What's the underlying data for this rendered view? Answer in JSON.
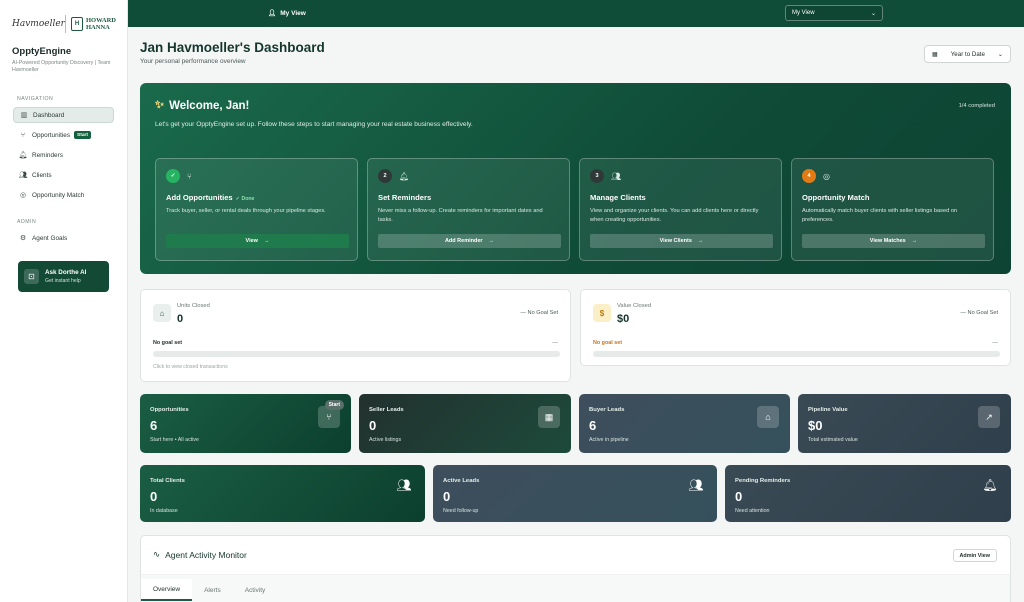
{
  "sidebar": {
    "logo_left": "Havmoeller",
    "logo_right_top": "HOWARD",
    "logo_right_bottom": "HANNA",
    "logo_seal": "H",
    "app_name": "OpptyEngine",
    "tagline": "AI-Powered Opportunity Discovery | Team Havmoeller",
    "nav_label": "NAVIGATION",
    "items": [
      {
        "label": "Dashboard",
        "icon": "bar-chart-icon"
      },
      {
        "label": "Opportunities",
        "icon": "git-branch-icon",
        "badge": "Start"
      },
      {
        "label": "Reminders",
        "icon": "bell-icon"
      },
      {
        "label": "Clients",
        "icon": "users-icon"
      },
      {
        "label": "Opportunity Match",
        "icon": "target-icon"
      }
    ],
    "admin_label": "ADMIN",
    "admin_items": [
      {
        "label": "Agent Goals",
        "icon": "gear-icon"
      }
    ],
    "ask": {
      "title": "Ask Dorthe AI",
      "subtitle": "Get instant help"
    }
  },
  "topbar": {
    "view_label": "My View",
    "select_value": "My View"
  },
  "header": {
    "title": "Jan Havmoeller's Dashboard",
    "subtitle": "Your personal performance overview",
    "period": "Year to Date"
  },
  "welcome": {
    "title": "Welcome, Jan!",
    "completed": "1/4 completed",
    "description": "Let's get your OpptyEngine set up. Follow these steps to start managing your real estate business effectively.",
    "steps": [
      {
        "num": "✓",
        "title": "Add Opportunities",
        "done_tag": "✓ Done",
        "desc": "Track buyer, seller, or rental deals through your pipeline stages.",
        "button": "View"
      },
      {
        "num": "2",
        "title": "Set Reminders",
        "desc": "Never miss a follow-up. Create reminders for important dates and tasks.",
        "button": "Add Reminder"
      },
      {
        "num": "3",
        "title": "Manage Clients",
        "desc": "View and organize your clients. You can add clients here or directly when creating opportunities.",
        "button": "View Clients"
      },
      {
        "num": "4",
        "title": "Opportunity Match",
        "desc": "Automatically match buyer clients with seller listings based on preferences.",
        "button": "View Matches"
      }
    ]
  },
  "goals": [
    {
      "label": "Units Closed",
      "value": "0",
      "goal": "— No Goal Set",
      "status": "No goal set",
      "dash": "—",
      "progress": 0,
      "caption": "Click to view closed transactions"
    },
    {
      "label": "Value Closed",
      "value": "$0",
      "goal": "— No Goal Set",
      "status": "No goal set",
      "dash": "—",
      "progress": 0,
      "icon": "$"
    }
  ],
  "stats": [
    {
      "label": "Opportunities",
      "value": "6",
      "sub": "Start here • All active",
      "badge": "Start"
    },
    {
      "label": "Seller Leads",
      "value": "0",
      "sub": "Active listings"
    },
    {
      "label": "Buyer Leads",
      "value": "6",
      "sub": "Active in pipeline"
    },
    {
      "label": "Pipeline Value",
      "value": "$0",
      "sub": "Total estimated value"
    },
    {
      "label": "Total Clients",
      "value": "0",
      "sub": "In database"
    },
    {
      "label": "Active Leads",
      "value": "0",
      "sub": "Need follow-up"
    },
    {
      "label": "Pending Reminders",
      "value": "0",
      "sub": "Need attention"
    }
  ],
  "monitor": {
    "title": "Agent Activity Monitor",
    "admin_button": "Admin View",
    "tabs": [
      "Overview",
      "Alerts",
      "Activity"
    ]
  }
}
